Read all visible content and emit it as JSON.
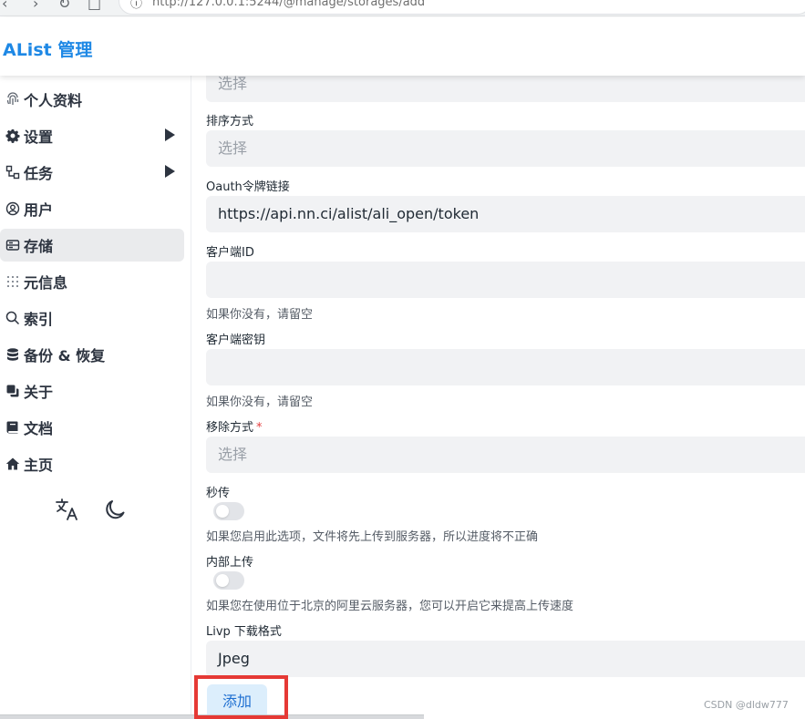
{
  "browser": {
    "url": "http://127.0.0.1:5244/@manage/storages/add"
  },
  "header": {
    "title": "AList 管理"
  },
  "sidebar": {
    "items": [
      {
        "label": "个人资料",
        "icon": "fingerprint-icon",
        "active": false,
        "expandable": false
      },
      {
        "label": "设置",
        "icon": "gear-icon",
        "active": false,
        "expandable": true
      },
      {
        "label": "任务",
        "icon": "tasks-icon",
        "active": false,
        "expandable": true
      },
      {
        "label": "用户",
        "icon": "user-icon",
        "active": false,
        "expandable": false
      },
      {
        "label": "存储",
        "icon": "storage-icon",
        "active": true,
        "expandable": false
      },
      {
        "label": "元信息",
        "icon": "metadata-icon",
        "active": false,
        "expandable": false
      },
      {
        "label": "索引",
        "icon": "search-icon",
        "active": false,
        "expandable": false
      },
      {
        "label": "备份 & 恢复",
        "icon": "database-icon",
        "active": false,
        "expandable": false
      },
      {
        "label": "关于",
        "icon": "copy-icon",
        "active": false,
        "expandable": false
      },
      {
        "label": "文档",
        "icon": "book-icon",
        "active": false,
        "expandable": false
      },
      {
        "label": "主页",
        "icon": "home-icon",
        "active": false,
        "expandable": false
      }
    ],
    "tools": {
      "language_icon": "translate-icon",
      "theme_icon": "moon-icon"
    }
  },
  "form": {
    "top_select": {
      "placeholder": "选择"
    },
    "order_by": {
      "label": "排序方式",
      "placeholder": "选择"
    },
    "oauth_url": {
      "label": "Oauth令牌链接",
      "value": "https://api.nn.ci/alist/ali_open/token"
    },
    "client_id": {
      "label": "客户端ID",
      "value": "",
      "help": "如果你没有，请留空"
    },
    "client_secret": {
      "label": "客户端密钥",
      "value": "",
      "help": "如果你没有，请留空"
    },
    "remove_way": {
      "label": "移除方式",
      "required_mark": "*",
      "placeholder": "选择"
    },
    "rapid_upload": {
      "label": "秒传",
      "enabled": false,
      "help": "如果您启用此选项，文件将先上传到服务器，所以进度将不正确"
    },
    "internal_upload": {
      "label": "内部上传",
      "enabled": false,
      "help": "如果您在使用位于北京的阿里云服务器，您可以开启它来提高上传速度"
    },
    "livp_format": {
      "label": "Livp 下载格式",
      "value": "Jpeg"
    },
    "submit_label": "添加"
  },
  "watermark": "CSDN @dldw777",
  "colors": {
    "brand": "#1e88e5",
    "active_bg": "#eaebed",
    "input_bg": "#f1f2f4",
    "button_bg": "#dceefc",
    "highlight": "#e53935",
    "required": "#e53e3e"
  }
}
